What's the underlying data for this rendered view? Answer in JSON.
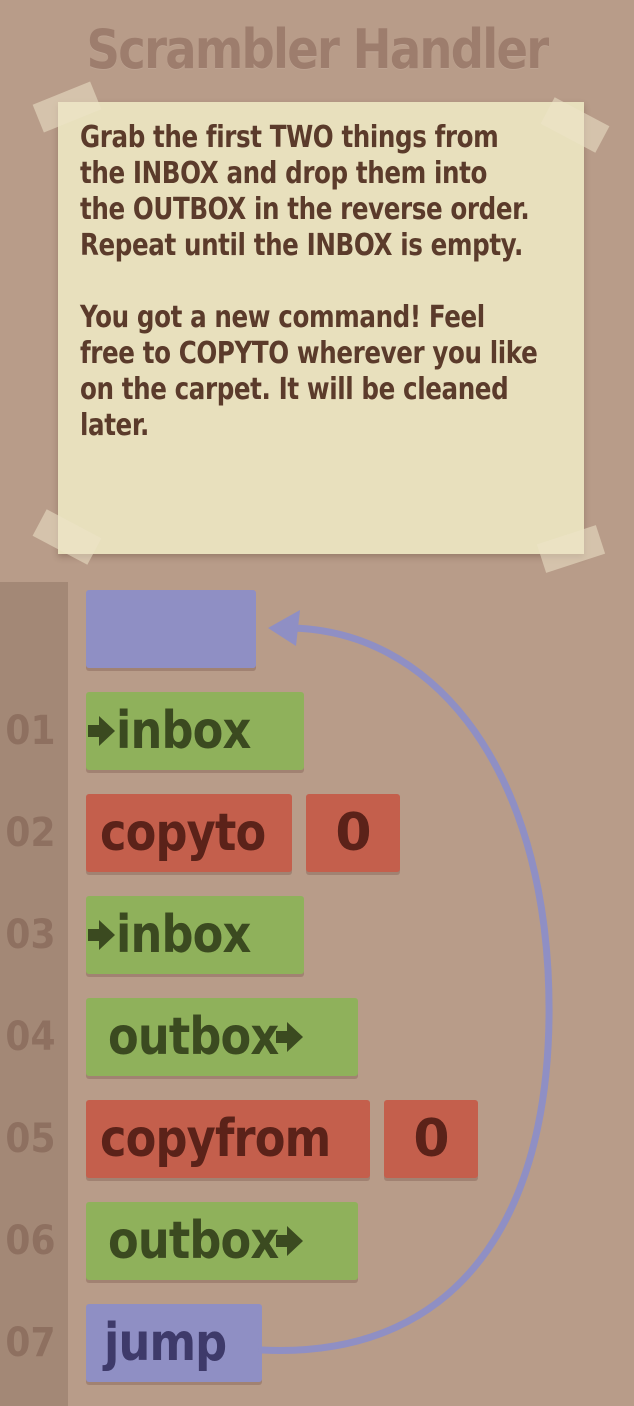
{
  "level": {
    "title": "Scrambler Handler"
  },
  "instructions": {
    "paragraph_1": "Grab the first TWO things from the INBOX and drop them into the OUTBOX in the reverse order. Repeat until the INBOX is empty.",
    "paragraph_2": "You got a new command! Feel free to COPYTO wherever you like on the carpet. It will be cleaned later."
  },
  "program": {
    "commands": [
      {
        "line": "01",
        "label": "inbox",
        "arg": ""
      },
      {
        "line": "02",
        "label": "copyto",
        "arg": "0"
      },
      {
        "line": "03",
        "label": "inbox",
        "arg": ""
      },
      {
        "line": "04",
        "label": "outbox",
        "arg": ""
      },
      {
        "line": "05",
        "label": "copyfrom",
        "arg": "0"
      },
      {
        "line": "06",
        "label": "outbox",
        "arg": ""
      },
      {
        "line": "07",
        "label": "jump",
        "arg": ""
      }
    ]
  },
  "icons": {
    "inbox_arrow": "arrow-right-icon",
    "outbox_arrow": "arrow-right-icon",
    "jump_arrow": "curved-arrow-icon"
  },
  "colors": {
    "background": "#b89c89",
    "note": "#e8e0bd",
    "io_command": "#8fb15b",
    "memory_command": "#c45f4c",
    "jump_command": "#8f8fc4"
  }
}
